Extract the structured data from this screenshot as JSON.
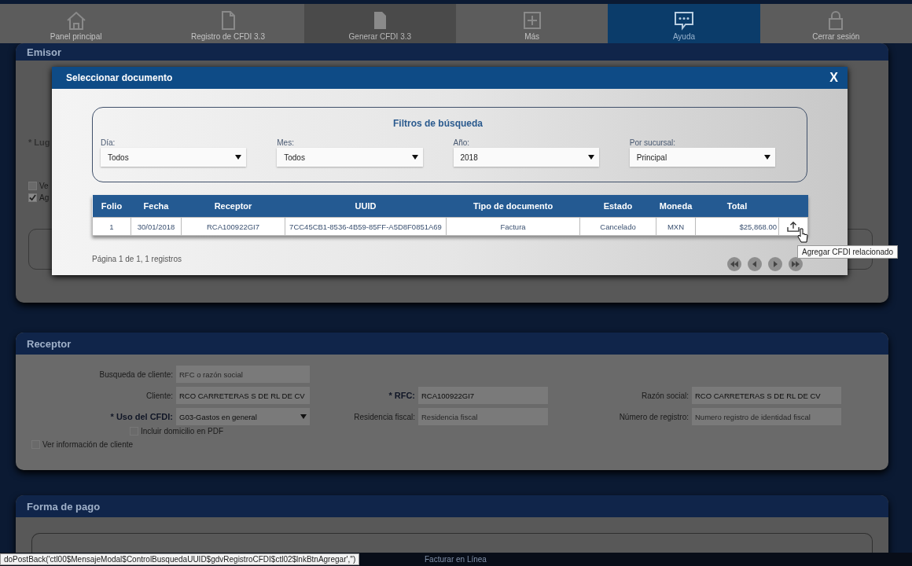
{
  "nav": {
    "items": [
      {
        "label": "Panel principal",
        "kind": "home",
        "selected": false
      },
      {
        "label": "Registro de CFDI 3.3",
        "kind": "document",
        "selected": false
      },
      {
        "label": "Generar CFDI 3.3",
        "kind": "filled",
        "selected": false
      },
      {
        "label": "Más",
        "kind": "plus",
        "selected": false
      },
      {
        "label": "Ayuda",
        "kind": "chat",
        "selected": true
      },
      {
        "label": "Cerrar sesión",
        "kind": "lock",
        "selected": false
      }
    ]
  },
  "emisor": {
    "title": "Emisor",
    "label": "* Lug",
    "checkboxes": [
      {
        "label": "Ve",
        "checked": false
      },
      {
        "label": "Ag",
        "checked": true
      }
    ]
  },
  "modal": {
    "title": "Seleccionar documento",
    "close": "X",
    "filters": {
      "title": "Filtros de búsqueda",
      "fields": [
        {
          "label": "Día:",
          "value": "Todos"
        },
        {
          "label": "Mes:",
          "value": "Todos"
        },
        {
          "label": "Año:",
          "value": "2018"
        },
        {
          "label": "Por sucursal:",
          "value": "Principal"
        }
      ]
    },
    "table": {
      "columns": [
        "Folio",
        "Fecha",
        "Receptor",
        "UUID",
        "Tipo de documento",
        "Estado",
        "Moneda",
        "Total"
      ],
      "rows": [
        {
          "cells": [
            "1",
            "30/01/2018",
            "RCA100922GI7",
            "7CC45CB1-8536-4B59-85FF-A5D8F0851A69",
            "Factura",
            "Cancelado",
            "MXN",
            "$25,868.00"
          ]
        }
      ]
    },
    "pagination": "Página 1 de 1, 1 registros",
    "tooltip": "Agregar CFDI relacionado"
  },
  "receptor": {
    "title": "Receptor",
    "columns": [
      [
        {
          "label": "Busqueda de cliente:",
          "placeholder": "RFC o razón social",
          "kind": "input"
        },
        {
          "label": "Cliente:",
          "value": "RCO CARRETERAS S DE RL DE CV",
          "kind": "input"
        },
        {
          "label": "* Uso del CFDI:",
          "value": "G03-Gastos en general",
          "kind": "select"
        }
      ],
      [
        {
          "label": "* RFC:",
          "value": "RCA100922GI7",
          "kind": "input"
        },
        {
          "label": "Residencia fiscal:",
          "placeholder": "Residencia fiscal",
          "kind": "input"
        }
      ],
      [
        {
          "label": "Razón social:",
          "value": "RCO CARRETERAS S DE RL DE CV",
          "kind": "input"
        },
        {
          "label": "Número de registro:",
          "placeholder": "Numero registro de identidad fiscal",
          "kind": "input"
        }
      ]
    ],
    "checkboxes": [
      {
        "label": "Incluir domicilio en PDF",
        "checked": false
      },
      {
        "label": "Ver información de cliente",
        "checked": false
      }
    ]
  },
  "forma_pago": {
    "title": "Forma de pago"
  },
  "status_bar": {
    "url": "doPostBack('ctl00$MensajeModal$ControlBusquedaUUID$gdvRegistroCFDI$ctl02$lnkBtnAgregar','')",
    "center": "Facturar en Línea"
  }
}
